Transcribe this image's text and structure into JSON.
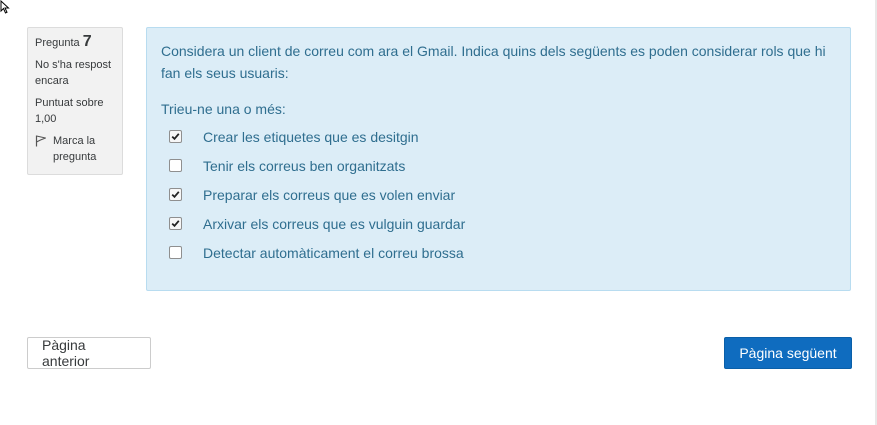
{
  "question_info": {
    "label": "Pregunta",
    "number": "7",
    "status": "No s'ha respost encara",
    "score": "Puntuat sobre 1,00",
    "flag_label": "Marca la pregunta"
  },
  "question": {
    "text": "Considera un client de correu com ara el Gmail. Indica quins dels següents es poden considerar rols que hi fan els seus usuaris:",
    "prompt": "Trieu-ne una o més:",
    "answers": [
      {
        "label": "Crear les etiquetes que es desitgin",
        "checked": true
      },
      {
        "label": "Tenir els correus ben organitzats",
        "checked": false
      },
      {
        "label": "Preparar els correus que es volen enviar",
        "checked": true
      },
      {
        "label": "Arxivar els correus que es vulguin guardar",
        "checked": true
      },
      {
        "label": "Detectar automàticament el correu brossa",
        "checked": false
      }
    ]
  },
  "navigation": {
    "prev_label": "Pàgina anterior",
    "next_label": "Pàgina següent"
  },
  "colors": {
    "question_bg": "#dcedf7",
    "question_text": "#2f6e8f",
    "primary": "#0f6cbf"
  }
}
